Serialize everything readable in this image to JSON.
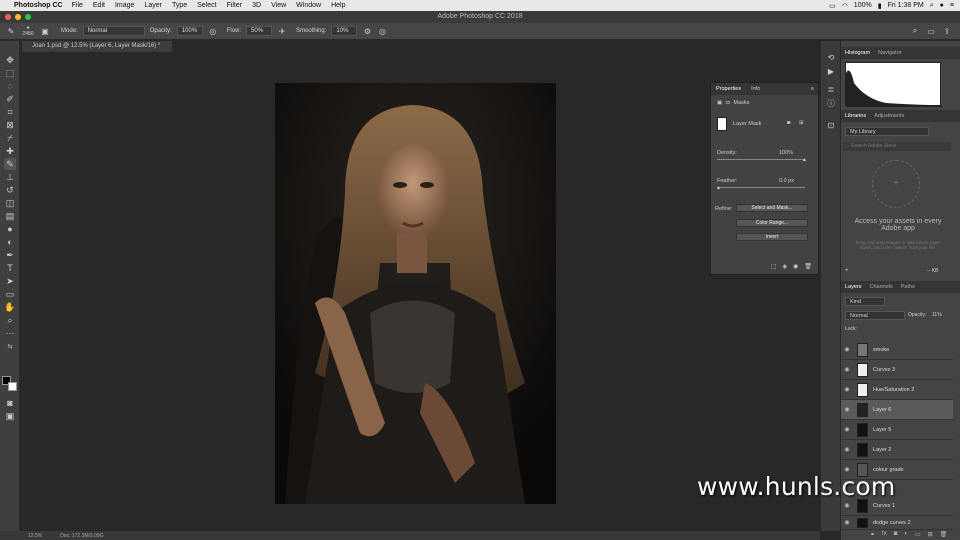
{
  "menubar": {
    "app_name": "Photoshop CC",
    "items": [
      "File",
      "Edit",
      "Image",
      "Layer",
      "Type",
      "Select",
      "Filter",
      "3D",
      "View",
      "Window",
      "Help"
    ],
    "battery": "100%",
    "clock": "Fri 1:38 PM"
  },
  "window": {
    "title": "Adobe Photoshop CC 2018"
  },
  "options": {
    "brush_size": "2480",
    "mode_label": "Mode:",
    "mode_value": "Normal",
    "opacity_label": "Opacity:",
    "opacity_value": "100%",
    "flow_label": "Flow:",
    "flow_value": "50%",
    "smoothing_label": "Smoothing:",
    "smoothing_value": "10%"
  },
  "document": {
    "tab_label": "Joan 1.psd @ 12.5% (Layer 6, Layer Mask/16) *"
  },
  "status": {
    "zoom": "12.5%",
    "doc": "Doc: 172.3M/3.09G"
  },
  "properties": {
    "tab_active": "Properties",
    "tab_other": "Info",
    "section": "Masks",
    "mask_type": "Layer Mask",
    "density_label": "Density:",
    "density_value": "100%",
    "feather_label": "Feather:",
    "feather_value": "0.0 px",
    "refine_label": "Refine:",
    "btn_select_mask": "Select and Mask...",
    "btn_color_range": "Color Range...",
    "btn_invert": "Invert"
  },
  "dock": {
    "histogram_tab": "Histogram",
    "navigator_tab": "Navigator",
    "libraries_tab": "Libraries",
    "adjustments_tab": "Adjustments",
    "library_name": "My Library",
    "search_placeholder": "Search Adobe Stock",
    "assets_title": "Access your assets in every Adobe app",
    "assets_sub": "Drag and drop images or add colors, layer styles, and other assets from your file.",
    "storage": "-- KB",
    "layers_tab": "Layers",
    "channels_tab": "Channels",
    "paths_tab": "Paths",
    "kind_label": "Kind",
    "blend_mode": "Normal",
    "opacity_label": "Opacity:",
    "opacity_value": "11%",
    "lock_label": "Lock:",
    "layers": [
      {
        "name": "smoke",
        "thumb": "#777"
      },
      {
        "name": "Curves 3",
        "thumb": "#eee"
      },
      {
        "name": "Hue/Saturation 2",
        "thumb": "#eee"
      },
      {
        "name": "Layer 6",
        "thumb": "#222"
      },
      {
        "name": "Layer 5",
        "thumb": "#111"
      },
      {
        "name": "Layer 2",
        "thumb": "#111"
      },
      {
        "name": "colour grade",
        "thumb": "#555"
      },
      {
        "name": "Curves 1",
        "thumb": "#111"
      },
      {
        "name": "dodge curves 2",
        "thumb": "#111"
      }
    ]
  },
  "watermark": "www.hunls.com"
}
